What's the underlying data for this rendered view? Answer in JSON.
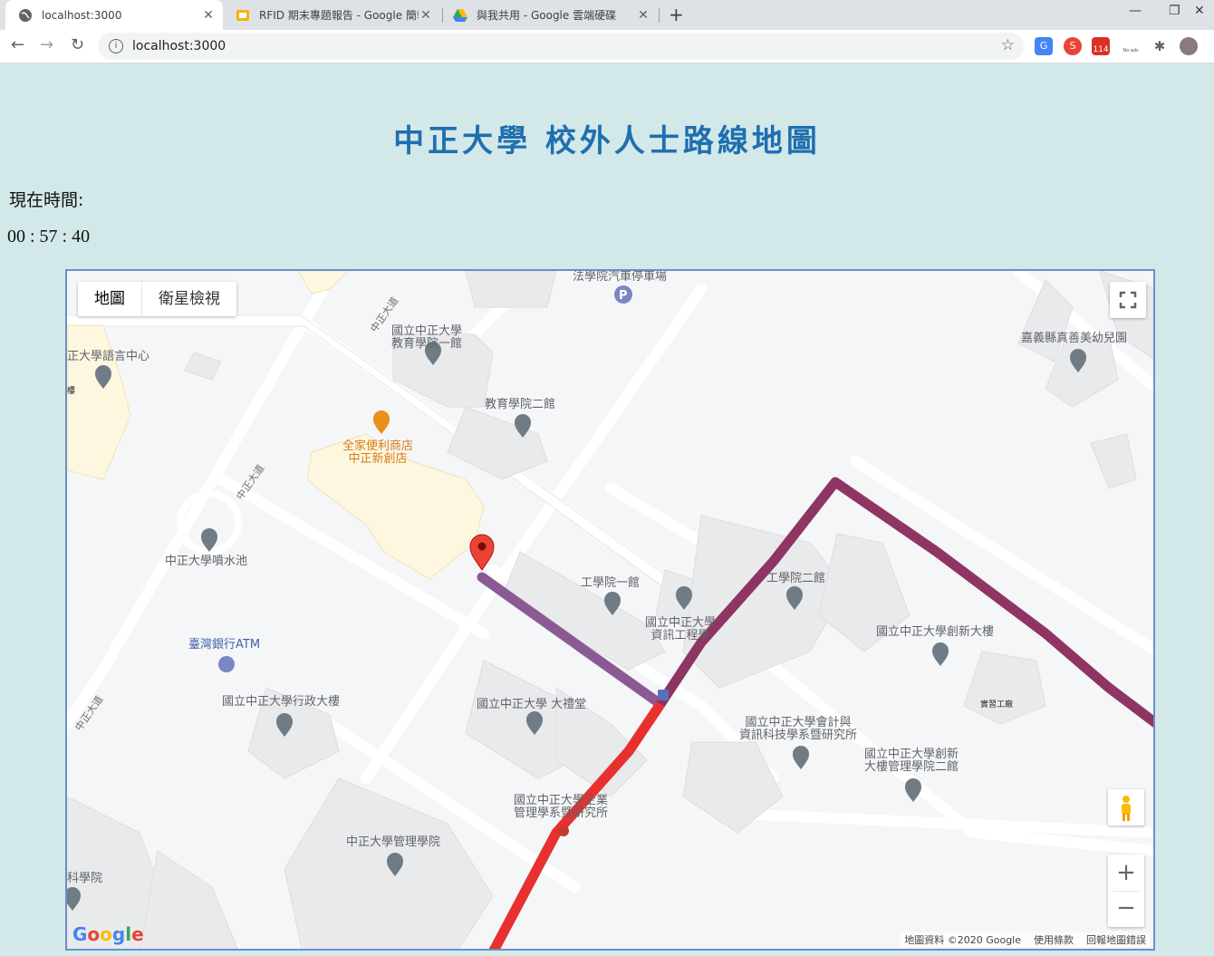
{
  "browser": {
    "tabs": [
      {
        "title": "localhost:3000",
        "active": true
      },
      {
        "title": "RFID 期末專題報告 - Google 簡報",
        "active": false
      },
      {
        "title": "與我共用 - Google 雲端硬碟",
        "active": false
      }
    ],
    "url": "localhost:3000",
    "extensions": {
      "mail_badge": "114",
      "noads_label": "No ads"
    }
  },
  "page": {
    "title": "中正大學 校外人士路線地圖",
    "time_label": "現在時間:",
    "time_value": "00 : 57 : 40"
  },
  "map": {
    "type_buttons": {
      "map": "地圖",
      "satellite": "衛星檢視"
    },
    "zoom_in": "+",
    "zoom_out": "−",
    "attribution": {
      "data": "地圖資料 ©2020 Google",
      "terms": "使用條款",
      "report": "回報地圖錯誤"
    },
    "labels": {
      "parking": "法學院汽車停車場",
      "edu1": [
        "國立中正大學",
        "教育學院一館"
      ],
      "edu2": "教育學院二館",
      "lang": "正大學語言中心",
      "lang_small": "樓",
      "store": [
        "全家便利商店",
        "中正新創店"
      ],
      "fountain": "中正大學噴水池",
      "eng1": "工學院一館",
      "csie": [
        "國立中正大學",
        "資訊工程學"
      ],
      "eng2": "工學院二館",
      "innov": "國立中正大學創新大樓",
      "kinder": "嘉義縣真善美幼兒園",
      "atm": "臺灣銀行ATM",
      "admin": "國立中正大學行政大樓",
      "auditorium": "國立中正大學 大禮堂",
      "accounting": [
        "國立中正大學會計與",
        "資訊科技學系暨研究所"
      ],
      "factory": "實習工廠",
      "mgmt2": [
        "國立中正大學創新",
        "大樓管理學院二館"
      ],
      "bizmgmt": [
        "國立中正大學企業",
        "管理學系暨研究所"
      ],
      "mgmt": "中正大學管理學院",
      "science": "科學院",
      "road": "中正大道"
    }
  },
  "colors": {
    "title": "#1f6eb0",
    "route_red": "#e8312f",
    "route_maroon": "#8e3564",
    "route_purple": "#8b5a93",
    "pin": "#ea4335",
    "poi": "#6f7c86",
    "background": "#d3e8e9"
  },
  "icons": [
    "globe-icon",
    "slides-icon",
    "drive-icon",
    "back-icon",
    "forward-icon",
    "reload-icon",
    "info-icon",
    "star-icon",
    "translate-icon",
    "extension-icon",
    "fullscreen-icon",
    "pegman-icon",
    "map-pin-icon",
    "school-icon",
    "food-icon",
    "parking-icon",
    "bank-icon"
  ]
}
